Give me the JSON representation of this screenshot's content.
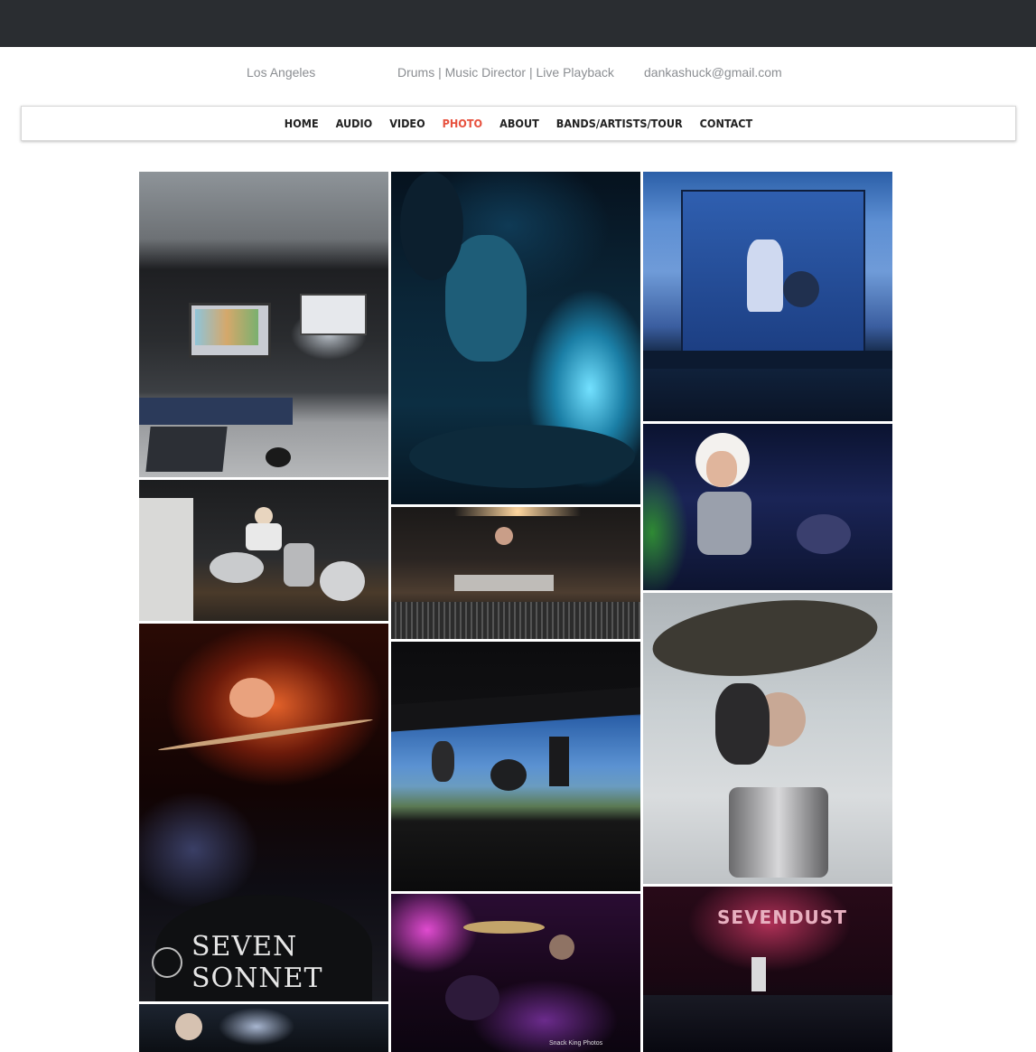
{
  "header": {
    "location": "Los Angeles",
    "roles": "Drums | Music Director | Live Playback",
    "email": "dankashuck@gmail.com"
  },
  "nav": {
    "items": [
      {
        "label": "HOME",
        "active": false
      },
      {
        "label": "AUDIO",
        "active": false
      },
      {
        "label": "VIDEO",
        "active": false
      },
      {
        "label": "PHOTO",
        "active": true
      },
      {
        "label": "ABOUT",
        "active": false
      },
      {
        "label": "BANDS/ARTISTS/TOUR",
        "active": false
      },
      {
        "label": "CONTACT",
        "active": false
      }
    ]
  },
  "gallery": {
    "photos": [
      {
        "id": "p1",
        "subject": "playback rig in arena",
        "caption": ""
      },
      {
        "id": "p2",
        "subject": "drummer in blue light",
        "caption": ""
      },
      {
        "id": "p3",
        "subject": "stage on video screen",
        "caption": ""
      },
      {
        "id": "p4",
        "subject": "drummer in studio",
        "caption": ""
      },
      {
        "id": "p5",
        "subject": "band rehearsal",
        "caption": ""
      },
      {
        "id": "p6",
        "subject": "blonde singer",
        "caption": ""
      },
      {
        "id": "p7",
        "subject": "drummer red lights",
        "caption": "SEVEN SONNET"
      },
      {
        "id": "p8",
        "subject": "outdoor stage",
        "caption": ""
      },
      {
        "id": "p9",
        "subject": "drummer behind cymbals",
        "caption": ""
      },
      {
        "id": "p10",
        "subject": "drummer purple lights",
        "caption": "Snack King Photos"
      },
      {
        "id": "p11",
        "subject": "band concert",
        "caption": "SEVENDUST"
      },
      {
        "id": "p12",
        "subject": "drummer dark stage",
        "caption": ""
      }
    ]
  }
}
